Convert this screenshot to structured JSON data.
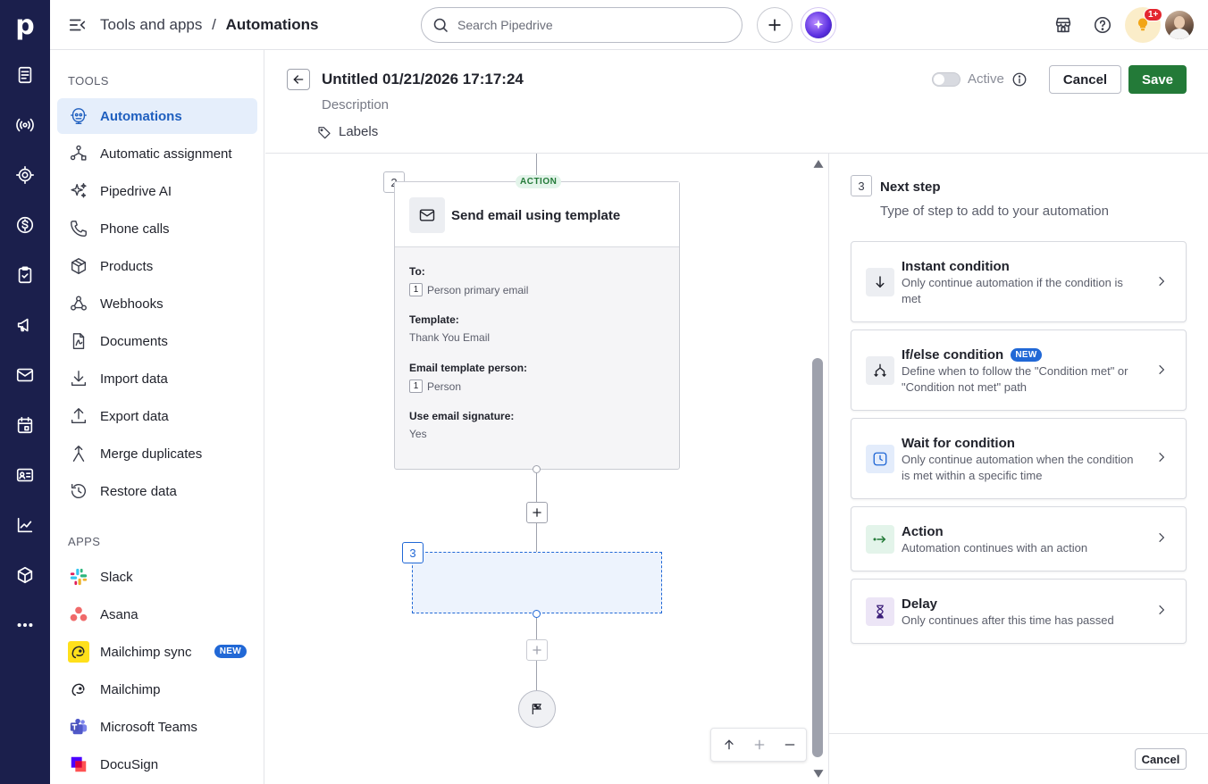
{
  "rail": {
    "logo": "p",
    "icons": [
      "leads-icon",
      "activity-radio-icon",
      "target-icon",
      "dollar-icon",
      "clipboard-icon",
      "megaphone-icon",
      "mail-icon",
      "calendar-icon",
      "contacts-card-icon",
      "chart-icon",
      "box-icon",
      "more-icon"
    ]
  },
  "topbar": {
    "breadcrumb_parent": "Tools and apps",
    "breadcrumb_sep": "/",
    "breadcrumb_current": "Automations",
    "search_placeholder": "Search Pipedrive",
    "notif_count": "1+"
  },
  "nav": {
    "tools_heading": "TOOLS",
    "tools": [
      {
        "label": "Automations",
        "icon": "automations-icon",
        "active": true
      },
      {
        "label": "Automatic assignment",
        "icon": "assignment-icon"
      },
      {
        "label": "Pipedrive AI",
        "icon": "sparkle-icon"
      },
      {
        "label": "Phone calls",
        "icon": "phone-icon"
      },
      {
        "label": "Products",
        "icon": "box-icon"
      },
      {
        "label": "Webhooks",
        "icon": "webhook-icon"
      },
      {
        "label": "Documents",
        "icon": "document-icon"
      },
      {
        "label": "Import data",
        "icon": "download-icon"
      },
      {
        "label": "Export data",
        "icon": "upload-icon"
      },
      {
        "label": "Merge duplicates",
        "icon": "merge-icon"
      },
      {
        "label": "Restore data",
        "icon": "restore-icon"
      }
    ],
    "apps_heading": "APPS",
    "apps": [
      {
        "label": "Slack",
        "icon": "slack-icon"
      },
      {
        "label": "Asana",
        "icon": "asana-icon"
      },
      {
        "label": "Mailchimp sync",
        "icon": "mailchimp-icon",
        "badge": "NEW"
      },
      {
        "label": "Mailchimp",
        "icon": "mailchimp-icon"
      },
      {
        "label": "Microsoft Teams",
        "icon": "teams-icon"
      },
      {
        "label": "DocuSign",
        "icon": "docusign-icon"
      }
    ]
  },
  "header": {
    "title": "Untitled 01/21/2026 17:17:24",
    "description": "Description",
    "labels": "Labels",
    "active_label": "Active",
    "cancel": "Cancel",
    "save": "Save"
  },
  "canvas": {
    "step2": {
      "number": "2",
      "tag": "ACTION",
      "title": "Send email using template",
      "fields": [
        {
          "label": "To:",
          "value": "Person primary email",
          "chip": "1"
        },
        {
          "label": "Template:",
          "value": "Thank You Email"
        },
        {
          "label": "Email template person:",
          "value": "Person",
          "chip": "1"
        },
        {
          "label": "Use email signature:",
          "value": "Yes"
        }
      ]
    },
    "step3": {
      "number": "3"
    }
  },
  "panel": {
    "step_number": "3",
    "title": "Next step",
    "subtitle": "Type of step to add to your automation",
    "options": [
      {
        "title": "Instant condition",
        "desc": "Only continue automation if the condition is met",
        "icon": "arrow-down-icon",
        "color": "#eceef2"
      },
      {
        "title": "If/else condition",
        "badge": "NEW",
        "desc": "Define when to follow the \"Condition met\" or \"Condition not met\" path",
        "icon": "branch-icon",
        "color": "#eceef2"
      },
      {
        "title": "Wait for condition",
        "desc": "Only continue automation when the condition is met within a specific time",
        "icon": "clock-icon",
        "color": "#e3ecfb"
      },
      {
        "title": "Action",
        "desc": "Automation continues with an action",
        "icon": "action-arrow-icon",
        "color": "#e3f4ea"
      },
      {
        "title": "Delay",
        "desc": "Only continues after this time has passed",
        "icon": "hourglass-icon",
        "color": "#ece5f6"
      }
    ],
    "cancel": "Cancel"
  },
  "colors": {
    "rail_bg": "#1b1f4c",
    "primary": "#237a38",
    "accent_blue": "#2168d6"
  }
}
